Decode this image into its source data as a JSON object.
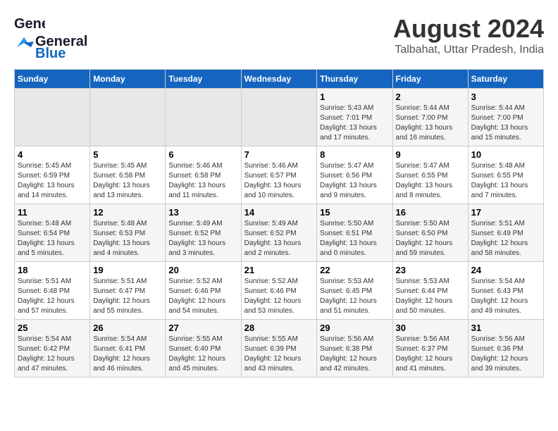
{
  "header": {
    "logo_general": "General",
    "logo_blue": "Blue",
    "title": "August 2024",
    "subtitle": "Talbahat, Uttar Pradesh, India"
  },
  "weekdays": [
    "Sunday",
    "Monday",
    "Tuesday",
    "Wednesday",
    "Thursday",
    "Friday",
    "Saturday"
  ],
  "weeks": [
    [
      {
        "day": "",
        "empty": true
      },
      {
        "day": "",
        "empty": true
      },
      {
        "day": "",
        "empty": true
      },
      {
        "day": "",
        "empty": true
      },
      {
        "day": "1",
        "sunrise": "5:43 AM",
        "sunset": "7:01 PM",
        "daylight": "13 hours and 17 minutes."
      },
      {
        "day": "2",
        "sunrise": "5:44 AM",
        "sunset": "7:00 PM",
        "daylight": "13 hours and 16 minutes."
      },
      {
        "day": "3",
        "sunrise": "5:44 AM",
        "sunset": "7:00 PM",
        "daylight": "13 hours and 15 minutes."
      }
    ],
    [
      {
        "day": "4",
        "sunrise": "5:45 AM",
        "sunset": "6:59 PM",
        "daylight": "13 hours and 14 minutes."
      },
      {
        "day": "5",
        "sunrise": "5:45 AM",
        "sunset": "6:58 PM",
        "daylight": "13 hours and 13 minutes."
      },
      {
        "day": "6",
        "sunrise": "5:46 AM",
        "sunset": "6:58 PM",
        "daylight": "13 hours and 11 minutes."
      },
      {
        "day": "7",
        "sunrise": "5:46 AM",
        "sunset": "6:57 PM",
        "daylight": "13 hours and 10 minutes."
      },
      {
        "day": "8",
        "sunrise": "5:47 AM",
        "sunset": "6:56 PM",
        "daylight": "13 hours and 9 minutes."
      },
      {
        "day": "9",
        "sunrise": "5:47 AM",
        "sunset": "6:55 PM",
        "daylight": "13 hours and 8 minutes."
      },
      {
        "day": "10",
        "sunrise": "5:48 AM",
        "sunset": "6:55 PM",
        "daylight": "13 hours and 7 minutes."
      }
    ],
    [
      {
        "day": "11",
        "sunrise": "5:48 AM",
        "sunset": "6:54 PM",
        "daylight": "13 hours and 5 minutes."
      },
      {
        "day": "12",
        "sunrise": "5:48 AM",
        "sunset": "6:53 PM",
        "daylight": "13 hours and 4 minutes."
      },
      {
        "day": "13",
        "sunrise": "5:49 AM",
        "sunset": "6:52 PM",
        "daylight": "13 hours and 3 minutes."
      },
      {
        "day": "14",
        "sunrise": "5:49 AM",
        "sunset": "6:52 PM",
        "daylight": "13 hours and 2 minutes."
      },
      {
        "day": "15",
        "sunrise": "5:50 AM",
        "sunset": "6:51 PM",
        "daylight": "13 hours and 0 minutes."
      },
      {
        "day": "16",
        "sunrise": "5:50 AM",
        "sunset": "6:50 PM",
        "daylight": "12 hours and 59 minutes."
      },
      {
        "day": "17",
        "sunrise": "5:51 AM",
        "sunset": "6:49 PM",
        "daylight": "12 hours and 58 minutes."
      }
    ],
    [
      {
        "day": "18",
        "sunrise": "5:51 AM",
        "sunset": "6:48 PM",
        "daylight": "12 hours and 57 minutes."
      },
      {
        "day": "19",
        "sunrise": "5:51 AM",
        "sunset": "6:47 PM",
        "daylight": "12 hours and 55 minutes."
      },
      {
        "day": "20",
        "sunrise": "5:52 AM",
        "sunset": "6:46 PM",
        "daylight": "12 hours and 54 minutes."
      },
      {
        "day": "21",
        "sunrise": "5:52 AM",
        "sunset": "6:46 PM",
        "daylight": "12 hours and 53 minutes."
      },
      {
        "day": "22",
        "sunrise": "5:53 AM",
        "sunset": "6:45 PM",
        "daylight": "12 hours and 51 minutes."
      },
      {
        "day": "23",
        "sunrise": "5:53 AM",
        "sunset": "6:44 PM",
        "daylight": "12 hours and 50 minutes."
      },
      {
        "day": "24",
        "sunrise": "5:54 AM",
        "sunset": "6:43 PM",
        "daylight": "12 hours and 49 minutes."
      }
    ],
    [
      {
        "day": "25",
        "sunrise": "5:54 AM",
        "sunset": "6:42 PM",
        "daylight": "12 hours and 47 minutes."
      },
      {
        "day": "26",
        "sunrise": "5:54 AM",
        "sunset": "6:41 PM",
        "daylight": "12 hours and 46 minutes."
      },
      {
        "day": "27",
        "sunrise": "5:55 AM",
        "sunset": "6:40 PM",
        "daylight": "12 hours and 45 minutes."
      },
      {
        "day": "28",
        "sunrise": "5:55 AM",
        "sunset": "6:39 PM",
        "daylight": "12 hours and 43 minutes."
      },
      {
        "day": "29",
        "sunrise": "5:56 AM",
        "sunset": "6:38 PM",
        "daylight": "12 hours and 42 minutes."
      },
      {
        "day": "30",
        "sunrise": "5:56 AM",
        "sunset": "6:37 PM",
        "daylight": "12 hours and 41 minutes."
      },
      {
        "day": "31",
        "sunrise": "5:56 AM",
        "sunset": "6:36 PM",
        "daylight": "12 hours and 39 minutes."
      }
    ]
  ]
}
